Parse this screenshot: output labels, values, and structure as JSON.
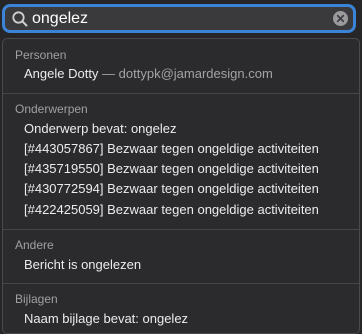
{
  "search": {
    "value": "ongelez"
  },
  "sections": {
    "personen": {
      "title": "Personen",
      "items": [
        {
          "name": "Angele Dotty",
          "separator": " — ",
          "email": "dottypk@jamardesign.com"
        }
      ]
    },
    "onderwerpen": {
      "title": "Onderwerpen",
      "items": [
        "Onderwerp bevat: ongelez",
        "[#443057867] Bezwaar tegen ongeldige activiteiten",
        "[#435719550] Bezwaar tegen ongeldige activiteiten",
        "[#430772594] Bezwaar tegen ongeldige activiteiten",
        "[#422425059] Bezwaar tegen ongeldige activiteiten"
      ]
    },
    "andere": {
      "title": "Andere",
      "items": [
        "Bericht is ongelezen"
      ]
    },
    "bijlagen": {
      "title": "Bijlagen",
      "items": [
        "Naam bijlage bevat: ongelez"
      ]
    }
  },
  "colors": {
    "focus_ring": "#3b83d6",
    "panel_bg": "#2b2a2d",
    "text_primary": "#ececef",
    "text_secondary": "#a0a0a4"
  },
  "icons": {
    "search": "magnifying-glass",
    "clear": "circled-x"
  }
}
